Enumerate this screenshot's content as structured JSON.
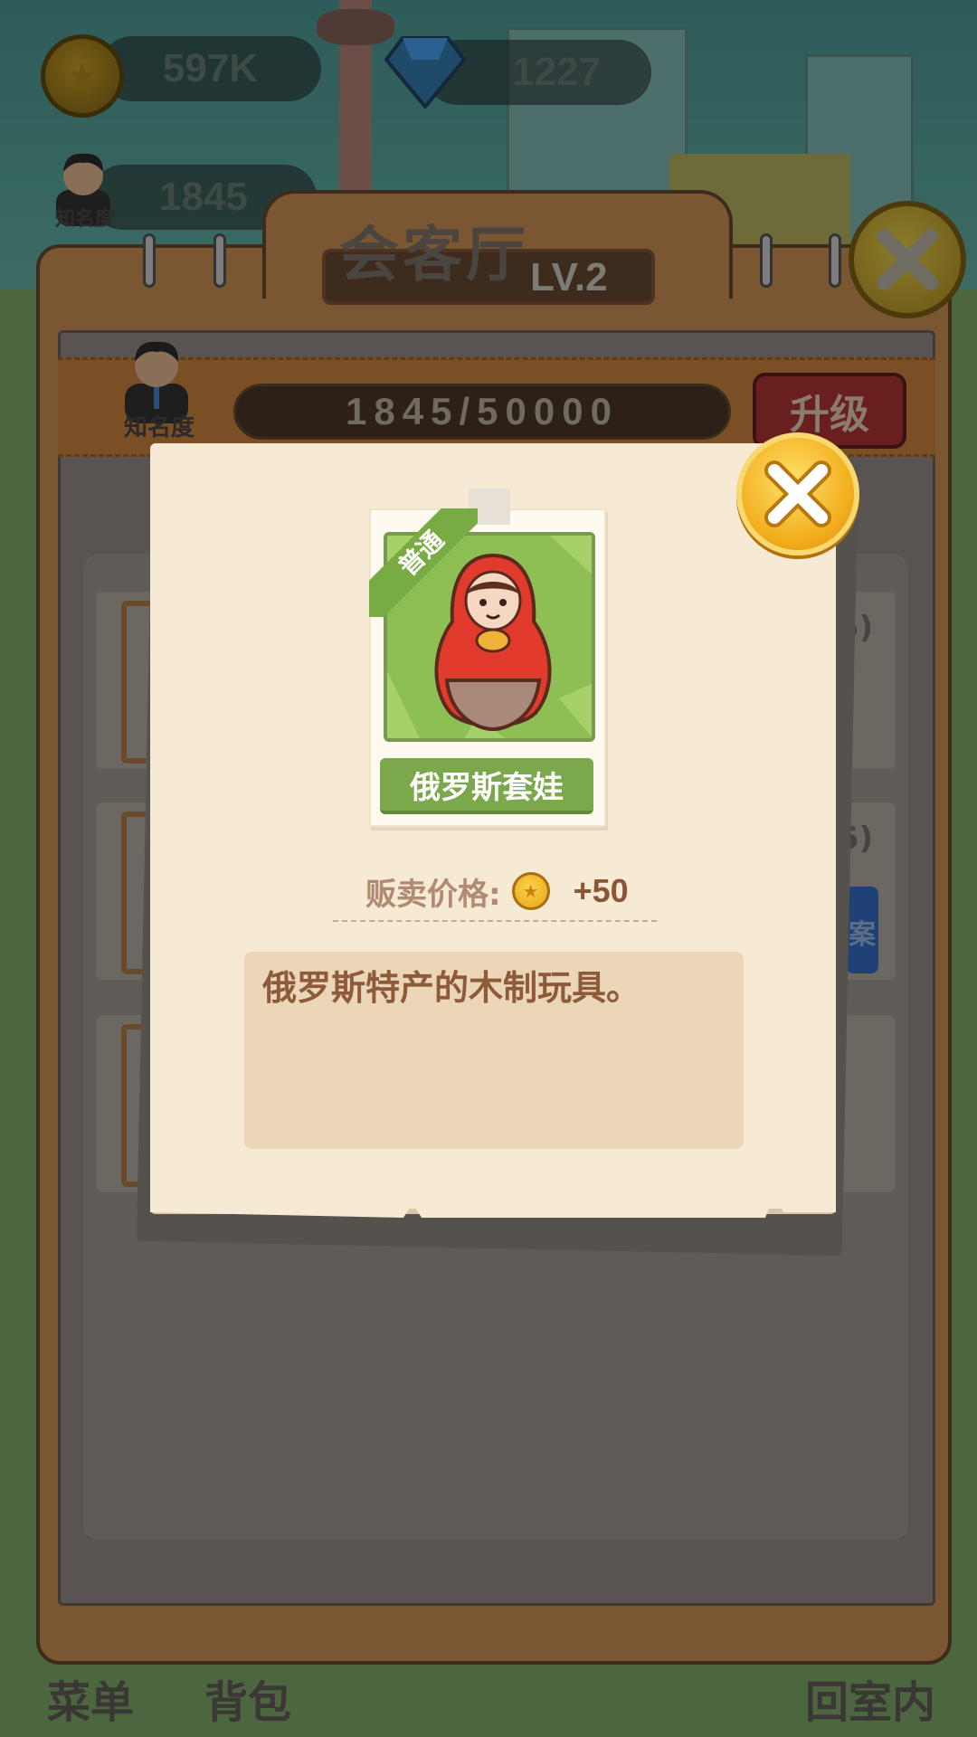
{
  "hud": {
    "coins": "597K",
    "gems": "1227",
    "fame_value": "1845",
    "fame_label": "知名度"
  },
  "panel": {
    "title": "会客厅",
    "level": "LV.2",
    "progress": "1845/50000",
    "progress_fraction": 0.0369,
    "upgrade_label": "升级",
    "fame_label": "知名度",
    "row_suffix": "5)",
    "row_button_fragment": "案"
  },
  "bottom_nav": {
    "menu": "菜单",
    "bag": "背包",
    "return_indoor": "回室内"
  },
  "item_popup": {
    "rarity": "普通",
    "name": "俄罗斯套娃",
    "price_label": "贩卖价格:",
    "price_value": "+50",
    "description": "俄罗斯特产的木制玩具。",
    "icons": {
      "item": "matryoshka-doll-icon",
      "price_coin": "coin-icon",
      "close": "close-icon"
    }
  },
  "colors": {
    "card_bg": "#f7ead5",
    "rarity_green": "#79ab45",
    "close_gold": "#f2ad1c",
    "desc_text": "#8d5a3a"
  }
}
